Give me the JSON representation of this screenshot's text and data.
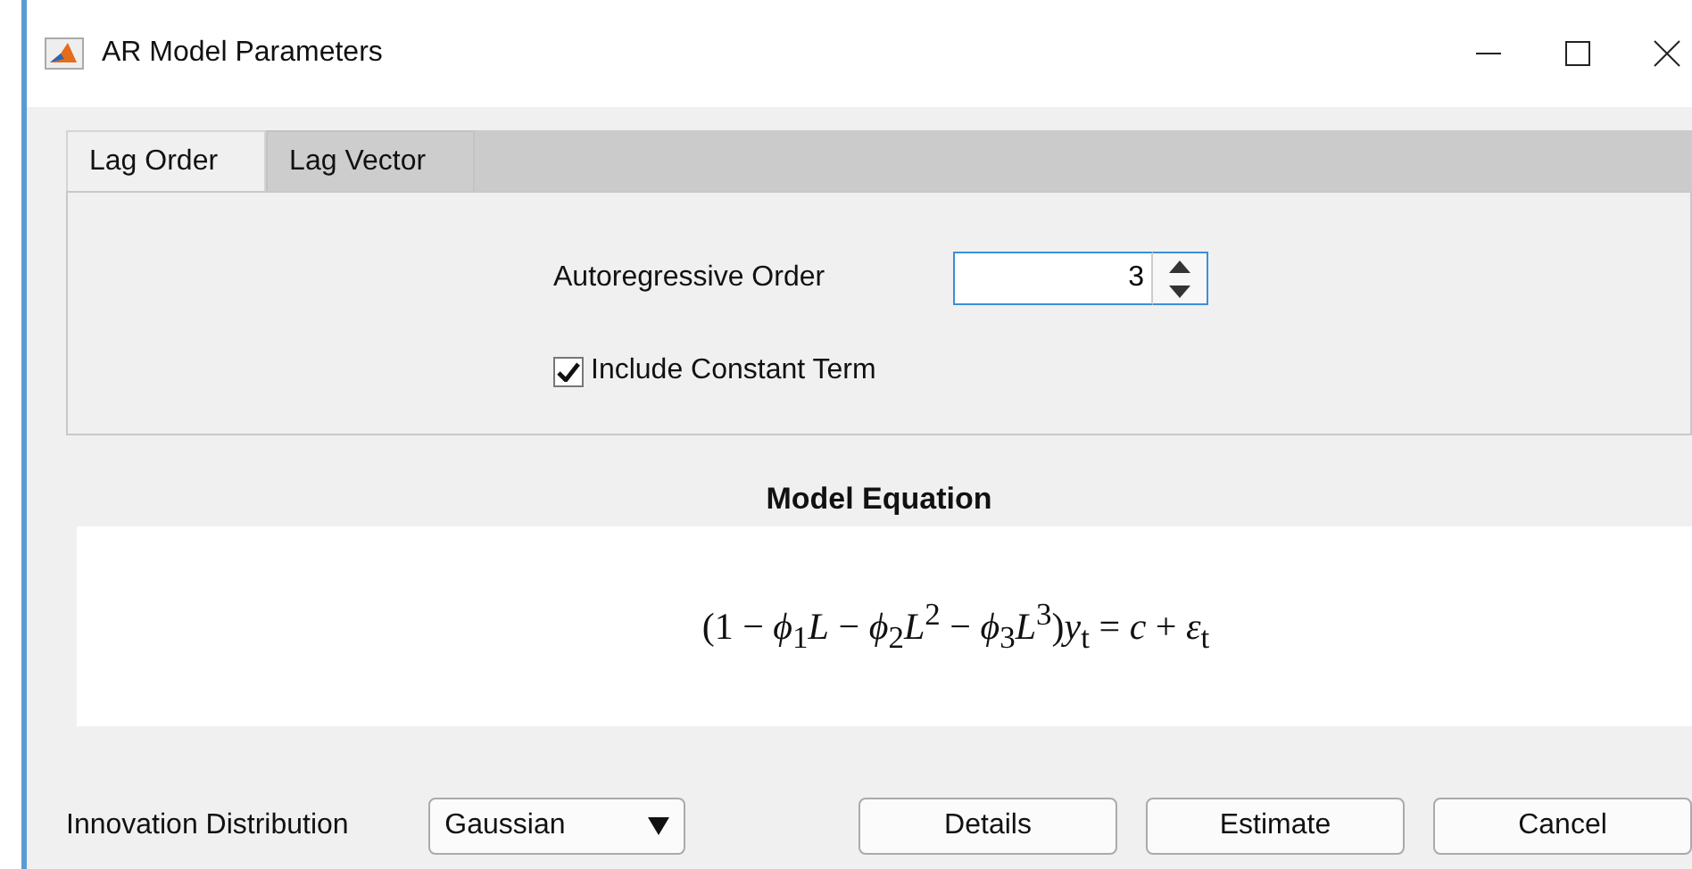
{
  "window": {
    "title": "AR Model Parameters"
  },
  "tabs": [
    {
      "label": "Lag Order",
      "selected": true
    },
    {
      "label": "Lag Vector",
      "selected": false
    }
  ],
  "lag_order": {
    "label": "Autoregressive Order",
    "value": "3",
    "include_constant": {
      "label": "Include Constant Term",
      "checked": true
    }
  },
  "model_equation": {
    "title": "Model Equation",
    "equation": "(1 − *ϕ*$_{1}$*L* − *ϕ*$_{2}$*L*$^{2}$ − *ϕ*$_{3}$*L*$^{3}$)*y*$_{t}$ = *c* + *ε*$_{t}$"
  },
  "innovation": {
    "label": "Innovation Distribution",
    "value": "Gaussian"
  },
  "buttons": [
    "Details",
    "Estimate",
    "Cancel"
  ]
}
